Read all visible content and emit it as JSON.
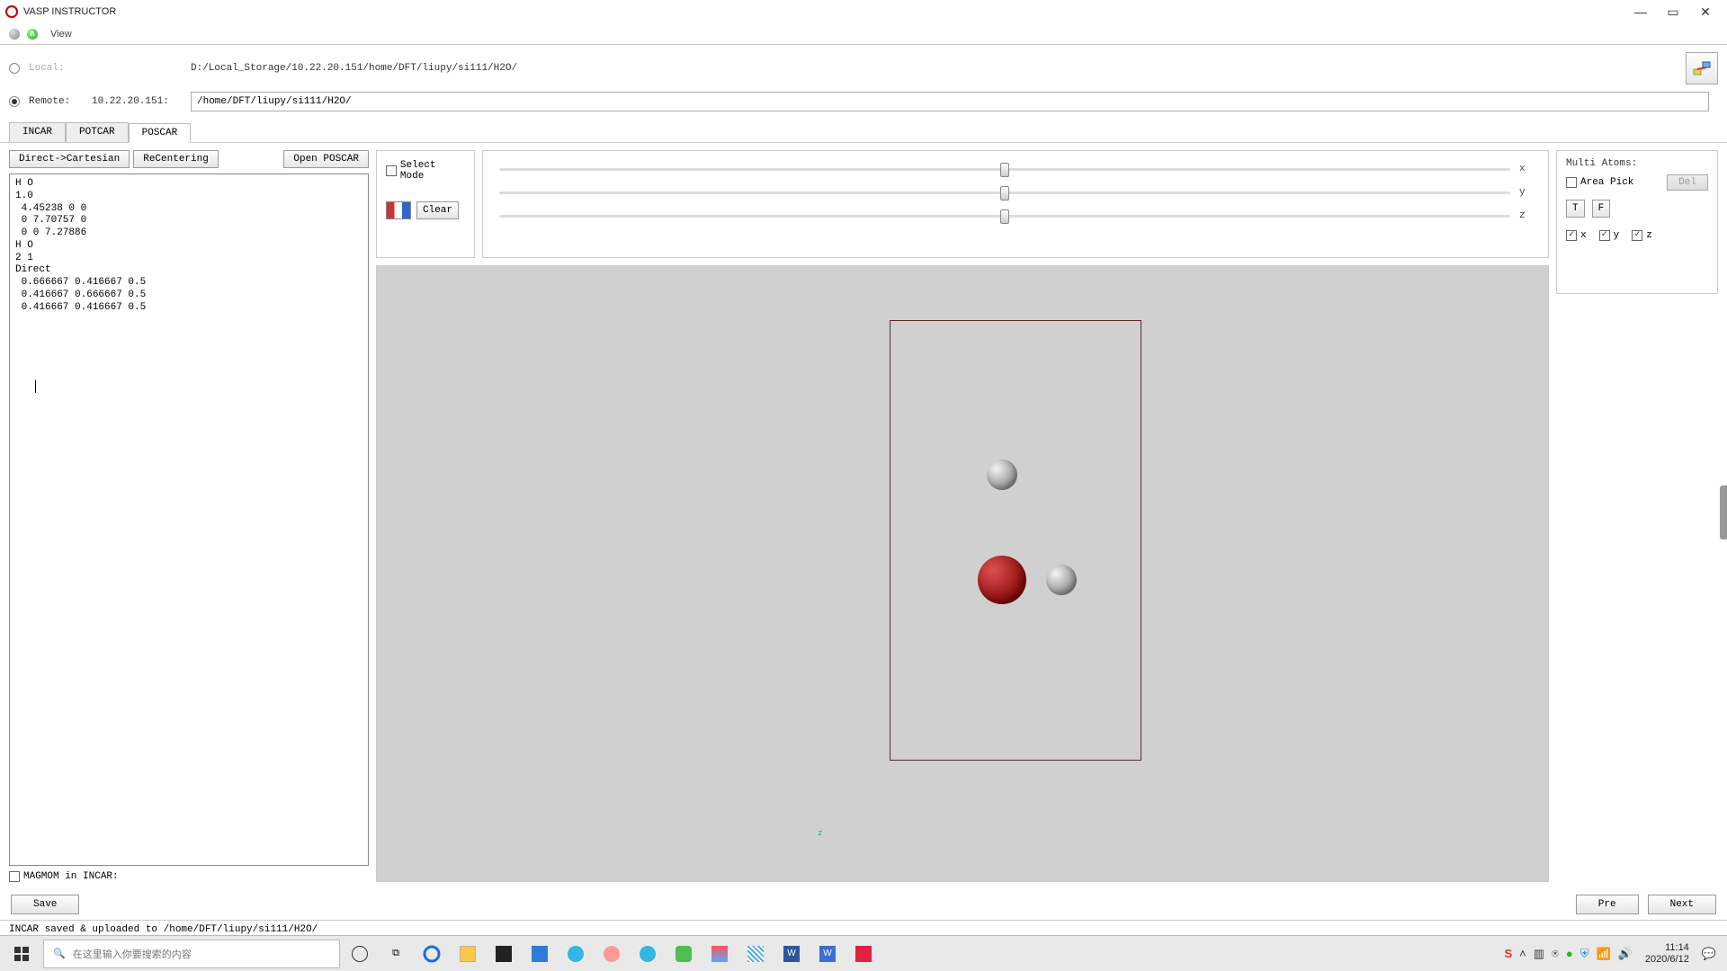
{
  "window": {
    "title": "VASP INSTRUCTOR"
  },
  "menu": {
    "view": "View"
  },
  "paths": {
    "local_label": "Local:",
    "local_path": "D:/Local_Storage/10.22.20.151/home/DFT/liupy/si111/H2O/",
    "remote_label": "Remote:",
    "remote_ip": "10.22.20.151:",
    "remote_path": "/home/DFT/liupy/si111/H2O/"
  },
  "tabs": {
    "incar": "INCAR",
    "potcar": "POTCAR",
    "poscar": "POSCAR"
  },
  "left": {
    "btn_direct": "Direct->Cartesian",
    "btn_recenter": "ReCentering",
    "btn_open": "Open POSCAR",
    "poscar_text": "H O\n1.0\n 4.45238 0 0\n 0 7.70757 0\n 0 0 7.27886\nH O\n2 1\nDirect\n 0.666667 0.416667 0.5\n 0.416667 0.666667 0.5\n 0.416667 0.416667 0.5",
    "magmom": "MAGMOM in INCAR:"
  },
  "center": {
    "select_mode": "Select Mode",
    "clear": "Clear",
    "slider_x": "x",
    "slider_y": "y",
    "slider_z": "z",
    "axis_z_viewer": "z"
  },
  "right": {
    "multi_atoms": "Multi Atoms:",
    "area_pick": "Area Pick",
    "del": "Del",
    "t": "T",
    "f": "F",
    "x": "x",
    "y": "y",
    "z": "z"
  },
  "bottom": {
    "save": "Save",
    "pre": "Pre",
    "next": "Next"
  },
  "status": {
    "msg": "INCAR saved & uploaded to /home/DFT/liupy/si111/H2O/"
  },
  "taskbar": {
    "search_placeholder": "在这里输入你要搜索的内容",
    "time": "11:14",
    "date": "2020/6/12"
  }
}
